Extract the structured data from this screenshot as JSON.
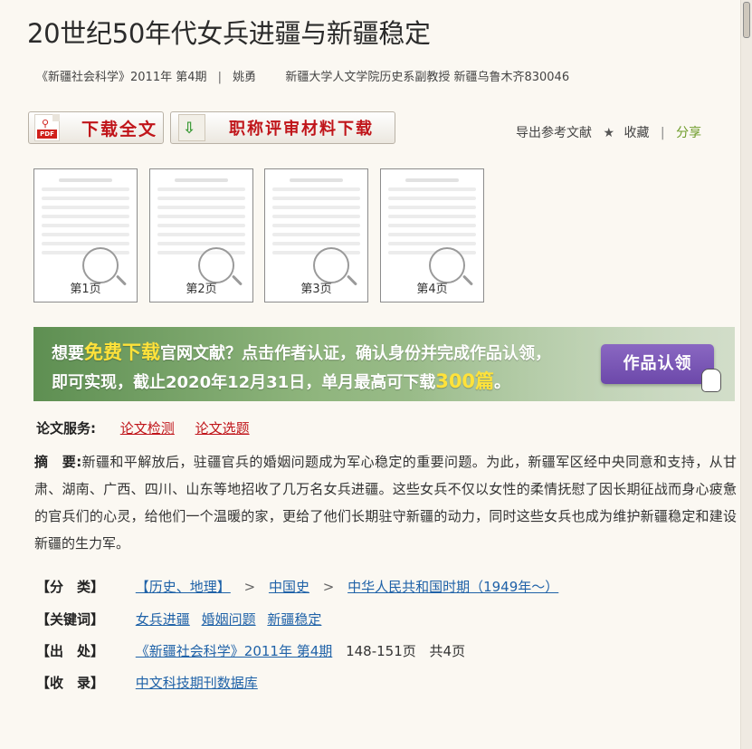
{
  "title": "20世纪50年代女兵进疆与新疆稳定",
  "meta": {
    "journal": "《新疆社会科学》2011年  第4期",
    "author": "姚勇",
    "affiliation": "新疆大学人文学院历史系副教授 新疆乌鲁木齐830046"
  },
  "buttons": {
    "download_full": "下载全文",
    "title_material": "职称评审材料下载"
  },
  "actions": {
    "export": "导出参考文献",
    "favorite": "收藏",
    "share": "分享"
  },
  "thumbnails": [
    {
      "label": "第1页"
    },
    {
      "label": "第2页"
    },
    {
      "label": "第3页"
    },
    {
      "label": "第4页"
    }
  ],
  "banner": {
    "line1_a": "想要",
    "line1_hl": "免费下载",
    "line1_b": "官网文献？点击作者认证，确认身份并完成作品认领，",
    "line2_a": "即可实现，截止2020年12月31日，单月最高可下载",
    "line2_hl": "300篇",
    "line2_b": "。",
    "claim_button": "作品认领"
  },
  "services": {
    "label": "论文服务:",
    "links": [
      "论文检测",
      "论文选题"
    ]
  },
  "abstract": {
    "label": "摘　要:",
    "text": "新疆和平解放后，驻疆官兵的婚姻问题成为军心稳定的重要问题。为此，新疆军区经中央同意和支持，从甘肃、湖南、广西、四川、山东等地招收了几万名女兵进疆。这些女兵不仅以女性的柔情抚慰了因长期征战而身心疲惫的官兵们的心灵，给他们一个温暖的家，更给了他们长期驻守新疆的动力，同时这些女兵也成为维护新疆稳定和建设新疆的生力军。"
  },
  "info": {
    "category_label": "【分　类】",
    "category": [
      "【历史、地理】",
      "中国史",
      "中华人民共和国时期（1949年～）"
    ],
    "keywords_label": "【关键词】",
    "keywords": [
      "女兵进疆",
      "婚姻问题",
      "新疆稳定"
    ],
    "source_label": "【出　处】",
    "source_link": "《新疆社会科学》2011年  第4期",
    "pages": "148-151页",
    "page_count": "共4页",
    "index_label": "【收　录】",
    "index": "中文科技期刊数据库"
  },
  "colors": {
    "link_red": "#c0151a",
    "link_blue": "#1f62a8",
    "share_green": "#6e9c2a",
    "banner_green": "#6f9d62",
    "claim_purple": "#7656b5"
  }
}
